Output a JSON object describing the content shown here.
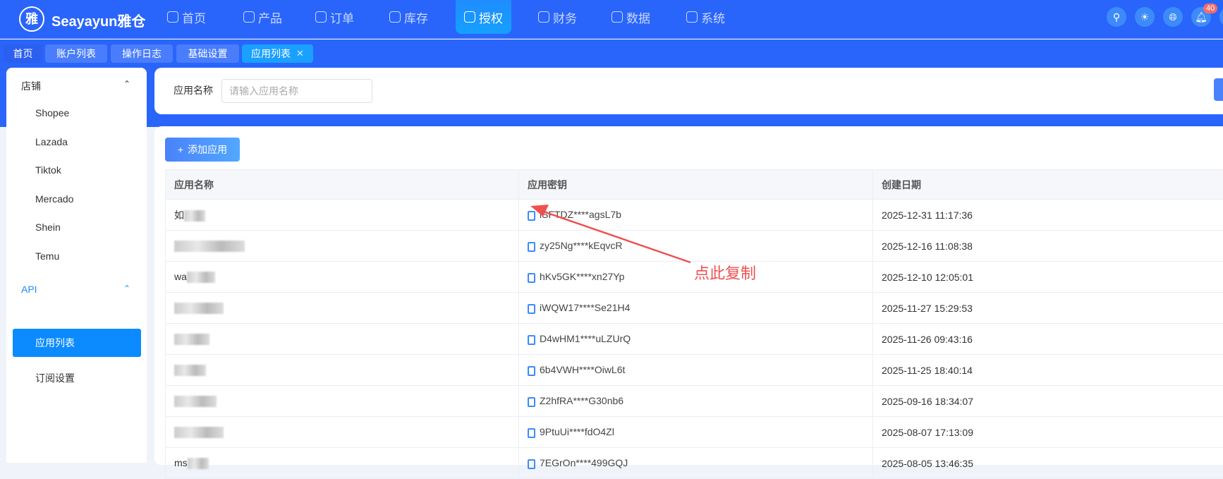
{
  "header": {
    "logo_glyph": "雅",
    "brand": "Seayayun雅仓",
    "nav": [
      {
        "label": "首页",
        "icon": "home-icon"
      },
      {
        "label": "产品",
        "icon": "box-icon"
      },
      {
        "label": "订单",
        "icon": "clipboard-icon"
      },
      {
        "label": "库存",
        "icon": "warehouse-icon"
      },
      {
        "label": "授权",
        "icon": "shield-icon",
        "active": true
      },
      {
        "label": "财务",
        "icon": "yen-icon"
      },
      {
        "label": "数据",
        "icon": "chart-icon"
      },
      {
        "label": "系统",
        "icon": "gear-icon"
      }
    ],
    "notification_count": "40"
  },
  "tabs": [
    {
      "label": "首页"
    },
    {
      "label": "账户列表"
    },
    {
      "label": "操作日志"
    },
    {
      "label": "基础设置"
    },
    {
      "label": "应用列表",
      "active": true
    }
  ],
  "sidebar": {
    "groups": [
      {
        "label": "店铺",
        "items": [
          "Shopee",
          "Lazada",
          "Tiktok",
          "Mercado",
          "Shein",
          "Temu"
        ]
      },
      {
        "label": "API",
        "items": [
          "应用列表",
          "订阅设置"
        ]
      }
    ]
  },
  "search": {
    "label": "应用名称",
    "placeholder": "请输入应用名称"
  },
  "toolbar": {
    "add_label": "添加应用"
  },
  "table": {
    "columns": [
      "应用名称",
      "应用密钥",
      "创建日期"
    ],
    "rows": [
      {
        "name": "如",
        "key": "iSFTDZ****agsL7b",
        "date": "2025-12-31 11:17:36"
      },
      {
        "name": "",
        "key": "zy25Ng****kEqvcR",
        "date": "2025-12-16 11:08:38"
      },
      {
        "name": "wa",
        "key": "hKv5GK****xn27Yp",
        "date": "2025-12-10 12:05:01"
      },
      {
        "name": "",
        "key": "iWQW17****Se21H4",
        "date": "2025-11-27 15:29:53"
      },
      {
        "name": "",
        "key": "D4wHM1****uLZUrQ",
        "date": "2025-11-26 09:43:16"
      },
      {
        "name": "",
        "key": "6b4VWH****OiwL6t",
        "date": "2025-11-25 18:40:14"
      },
      {
        "name": "",
        "key": "Z2hfRA****G30nb6",
        "date": "2025-09-16 18:34:07"
      },
      {
        "name": "",
        "key": "9PtuUi****fdO4Zl",
        "date": "2025-08-07 17:13:09"
      },
      {
        "name": "ms",
        "key": "7EGrOn****499GQJ",
        "date": "2025-08-05 13:46:35"
      }
    ]
  },
  "annotation": {
    "text": "点此复制",
    "color": "#f05050"
  },
  "colors": {
    "primary": "#2965fb",
    "active": "#0b8bff"
  }
}
